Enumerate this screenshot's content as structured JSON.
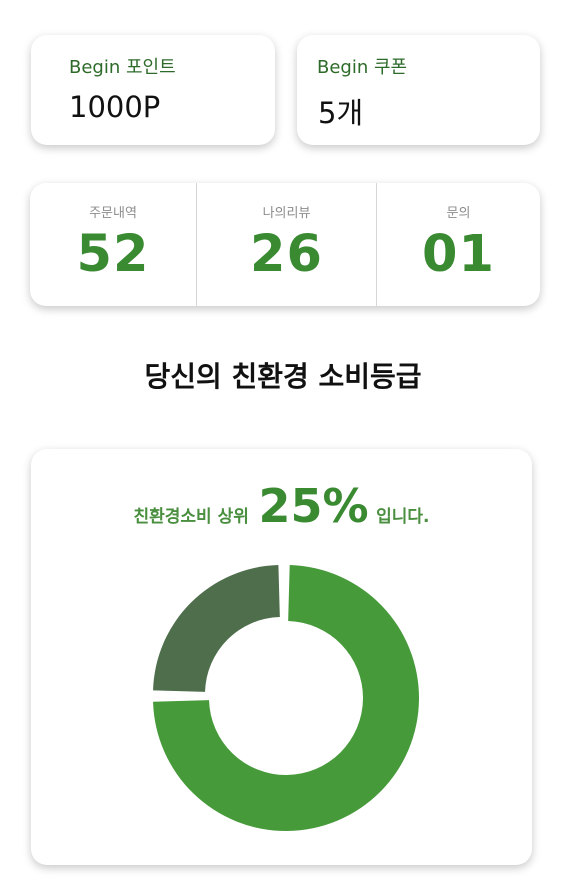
{
  "points": {
    "label": "Begin 포인트",
    "value": "1000P"
  },
  "coupons": {
    "label": "Begin 쿠폰",
    "value": "5개"
  },
  "stats": [
    {
      "label": "주문내역",
      "value": "52"
    },
    {
      "label": "나의리뷰",
      "value": "26"
    },
    {
      "label": "문의",
      "value": "01"
    }
  ],
  "section_title": "당신의 친환경 소비등급",
  "grade": {
    "prefix": "친환경소비 상위",
    "percent": "25%",
    "suffix": "입니다.",
    "top_fraction": 0.25
  },
  "colors": {
    "accent": "#3a8a32",
    "donut_main": "#469a3a",
    "donut_highlight": "#4e6e4c"
  }
}
